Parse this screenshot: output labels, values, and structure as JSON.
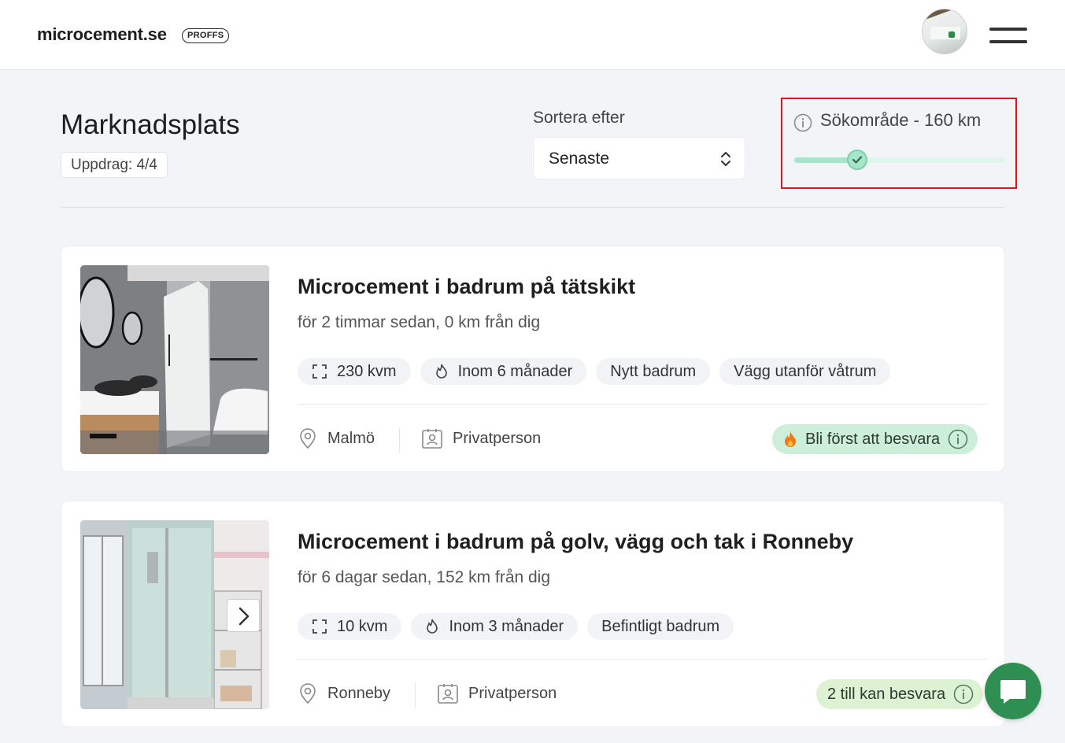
{
  "header": {
    "logo": "microcement.se",
    "badge": "PROFFS"
  },
  "page": {
    "title": "Marknadsplats",
    "count": "Uppdrag: 4/4"
  },
  "sort": {
    "label": "Sortera efter",
    "value": "Senaste"
  },
  "range": {
    "label": "Sökområde - 160 km",
    "value_km": 160,
    "slider_fraction": 0.3,
    "accent": "#a7e4c9"
  },
  "jobs": [
    {
      "title": "Microcement i badrum på tätskikt",
      "subtitle": "för 2 timmar sedan, 0 km från dig",
      "tags": [
        {
          "icon": "area-icon",
          "label": "230 kvm"
        },
        {
          "icon": "flame-icon",
          "label": "Inom 6 månader"
        },
        {
          "icon": "",
          "label": "Nytt badrum"
        },
        {
          "icon": "",
          "label": "Vägg utanför våtrum"
        }
      ],
      "location": "Malmö",
      "client": "Privatperson",
      "cta": "Bli först att besvara",
      "cta_icon": "fire-icon"
    },
    {
      "title": "Microcement i badrum på golv, vägg och tak i Ronneby",
      "subtitle": "för 6 dagar sedan, 152 km från dig",
      "tags": [
        {
          "icon": "area-icon",
          "label": "10 kvm"
        },
        {
          "icon": "flame-icon",
          "label": "Inom 3 månader"
        },
        {
          "icon": "",
          "label": "Befintligt badrum"
        }
      ],
      "location": "Ronneby",
      "client": "Privatperson",
      "cta": "2 till kan besvara",
      "cta_icon": ""
    }
  ],
  "colors": {
    "cta_green": "#cdeed9",
    "cta_lime": "#dcf2d2",
    "chat": "#2f8f52",
    "highlight": "#e0141e"
  }
}
